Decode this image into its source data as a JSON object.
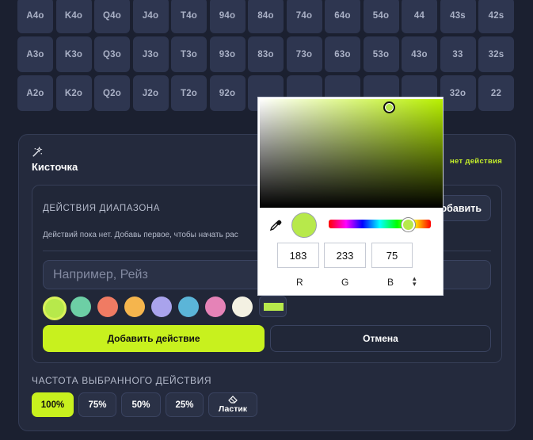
{
  "hand_grid": {
    "rows": [
      [
        "A4o",
        "K4o",
        "Q4o",
        "J4o",
        "T4o",
        "94o",
        "84o",
        "74o",
        "64o",
        "54o",
        "44",
        "43s",
        "42s"
      ],
      [
        "A3o",
        "K3o",
        "Q3o",
        "J3o",
        "T3o",
        "93o",
        "83o",
        "73o",
        "63o",
        "53o",
        "43o",
        "33",
        "32s"
      ],
      [
        "A2o",
        "K2o",
        "Q2o",
        "J2o",
        "T2o",
        "92o",
        "",
        "",
        "",
        "",
        "",
        "32o",
        "22"
      ]
    ]
  },
  "brush": {
    "icon": "magic-wand-icon",
    "title": "Кисточка",
    "status": "нет действия"
  },
  "range_actions": {
    "title": "ДЕЙСТВИЯ ДИАПАЗОНА",
    "add_button": "обавить",
    "empty_text": "Действий пока нет. Добавь первое, чтобы начать рас",
    "name_placeholder": "Например, Рейз",
    "name_value": "",
    "swatches": [
      "#b7e94b",
      "#6dcfa5",
      "#f07b63",
      "#f5b54d",
      "#a9a3ec",
      "#5bb5d8",
      "#e583b7",
      "#f3f1e2"
    ],
    "selected_swatch": "#b7e94b",
    "custom_color": "#b7e94b",
    "primary_button": "Добавить действие",
    "cancel_button": "Отмена"
  },
  "frequency": {
    "title": "ЧАСТОТА ВЫБРАННОГО ДЕЙСТВИЯ",
    "options": [
      "100%",
      "75%",
      "50%",
      "25%"
    ],
    "selected": "100%",
    "eraser_label": "Ластик",
    "eraser_icon": "eraser-icon"
  },
  "color_picker": {
    "hue_color": "#b8f000",
    "current_color": "#b7e94b",
    "r": "183",
    "g": "233",
    "b": "75",
    "labels": [
      "R",
      "G",
      "B"
    ],
    "dropper_icon": "eyedropper-icon",
    "mode_icon": "mode-toggle-icon"
  }
}
